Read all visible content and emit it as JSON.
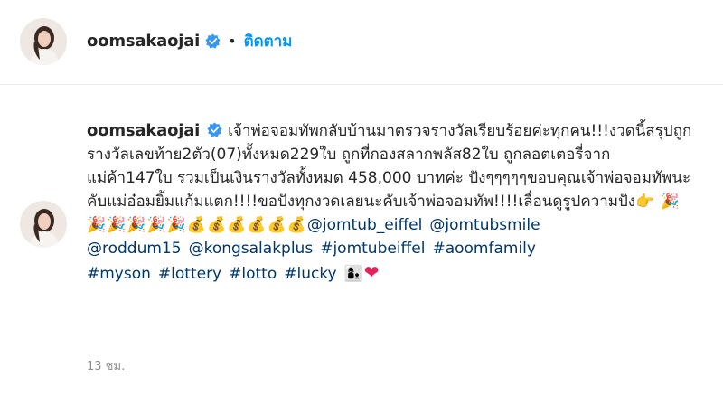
{
  "header": {
    "username": "oomsakaojai",
    "separator": "•",
    "follow_label": "ติดตาม"
  },
  "post": {
    "username": "oomsakaojai",
    "caption": "เจ้าพ่อจอมทัพกลับบ้านมาตรวจรางวัลเรียบร้อยค่ะทุกคน!!!งวดนี้สรุปถูกรางวัลเลขท้าย2ตัว(07)ทั้งหมด229ใบ ถูกที่กองสลากพลัส82ใบ ถูกลอตเตอรี่จากแม่ค้า147ใบ รวมเป็นเงินรางวัลทั้งหมด 458,000 บาทค่ะ ปังๆๆๆๆๆขอบคุณเจ้าพ่อจอมทัพนะคับแม่อ๋อมยิ้มแก้มแตก!!!!ขอปังทุกงวดเลยนะคับเจ้าพ่อจอมทัพ!!!!เลื่อนดูรูปความปัง",
    "caption_emojis_1": "👉",
    "caption_emojis_2": "🎉🎉🎉🎉🎉🎉💰💰💰💰💰💰",
    "tags": [
      "@jomtub_eiffel",
      "@jomtubsmile",
      "@roddum15",
      "@kongsalakplus",
      "#jomtubeiffel",
      "#aoomfamily",
      "#myson",
      "#lottery",
      "#lotto",
      "#lucky"
    ],
    "end_emojis": "👩‍👦",
    "heart": "❤",
    "time": "13 ชม."
  },
  "colors": {
    "link": "#00376b",
    "follow": "#0095f6",
    "verified": "#3897f0",
    "muted": "#8e8e8e"
  },
  "icons": {
    "verified": "verified-badge-icon",
    "heart": "heart-icon"
  }
}
